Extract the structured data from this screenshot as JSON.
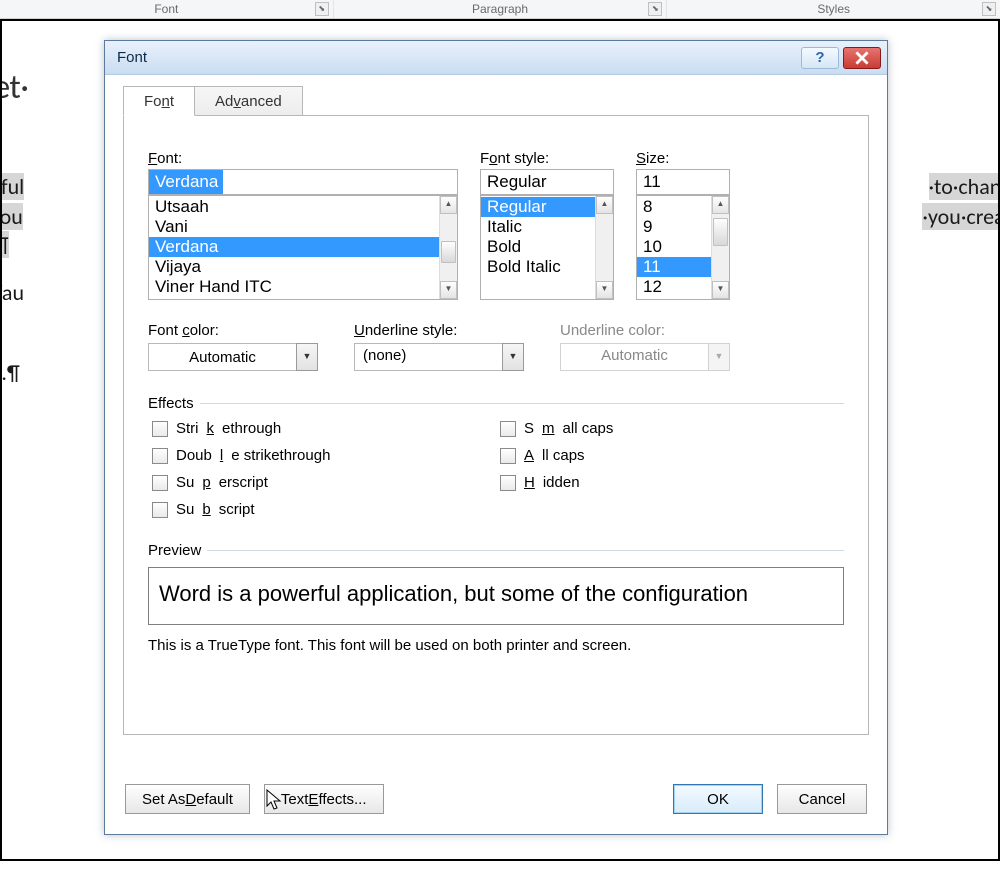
{
  "ribbon": {
    "groups": [
      {
        "label": "Font"
      },
      {
        "label": "Paragraph"
      },
      {
        "label": "Styles"
      }
    ]
  },
  "document": {
    "title_fragment": "to·Set·",
    "line1_left": "·a·powerful",
    "line1_right": "·to·change·",
    "line2_left": "·text·in·you",
    "line2_right": "·you·create·",
    "line3_left": "cument.¶",
    "line4_left": "g·the·defau",
    "line5_left": "ion...¶"
  },
  "dialog": {
    "title": "Font",
    "tabs": [
      "Font",
      "Advanced"
    ],
    "active_tab": 0,
    "font": {
      "label": "Font:",
      "value": "Verdana",
      "list": [
        "Utsaah",
        "Vani",
        "Verdana",
        "Vijaya",
        "Viner Hand ITC"
      ],
      "selected_index": 2
    },
    "style": {
      "label": "Font style:",
      "value": "Regular",
      "list": [
        "Regular",
        "Italic",
        "Bold",
        "Bold Italic"
      ],
      "selected_index": 0
    },
    "size": {
      "label": "Size:",
      "value": "11",
      "list": [
        "8",
        "9",
        "10",
        "11",
        "12"
      ],
      "selected_index": 3
    },
    "colors": {
      "font_color_label": "Font color:",
      "font_color_value": "Automatic",
      "underline_style_label": "Underline style:",
      "underline_style_value": "(none)",
      "underline_color_label": "Underline color:",
      "underline_color_value": "Automatic"
    },
    "effects": {
      "header": "Effects",
      "left": [
        "Strikethrough",
        "Double strikethrough",
        "Superscript",
        "Subscript"
      ],
      "right": [
        "Small caps",
        "All caps",
        "Hidden"
      ]
    },
    "preview": {
      "header": "Preview",
      "text": "Word is a powerful application, but some of the configuration",
      "note": "This is a TrueType font. This font will be used on both printer and screen."
    },
    "buttons": {
      "set_default": "Set As Default",
      "text_effects": "Text Effects...",
      "ok": "OK",
      "cancel": "Cancel"
    }
  }
}
